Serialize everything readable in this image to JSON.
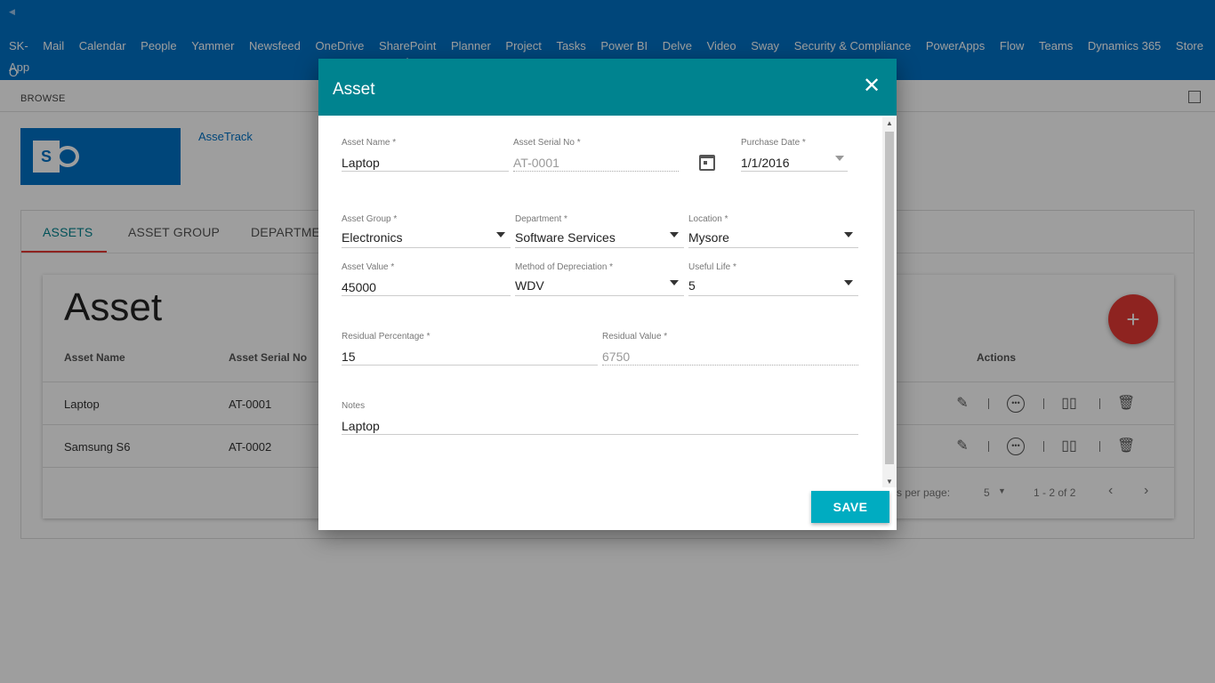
{
  "suite": {
    "links": [
      "SK-",
      "Mail",
      "Calendar",
      "People",
      "Yammer",
      "Newsfeed",
      "OneDrive",
      "SharePoint",
      "Planner",
      "Project",
      "Tasks",
      "Power BI",
      "Delve",
      "Video",
      "Sway",
      "Security & Compliance",
      "PowerApps",
      "Flow",
      "Teams",
      "Dynamics 365",
      "Store",
      "O"
    ],
    "app_label": "App",
    "active": "SharePoint"
  },
  "ribbon": {
    "browse": "BROWSE"
  },
  "site": {
    "logo_letter": "S",
    "title": "AsseTrack"
  },
  "tabs": [
    {
      "label": "ASSETS"
    },
    {
      "label": "ASSET GROUP"
    },
    {
      "label": "DEPARTMEN"
    }
  ],
  "table": {
    "title": "Asset",
    "headers": [
      "Asset Name",
      "Asset Serial No",
      "Actions"
    ],
    "rows": [
      {
        "name": "Laptop",
        "serial": "AT-0001"
      },
      {
        "name": "Samsung S6",
        "serial": "AT-0002"
      }
    ],
    "pager": {
      "rows_per_page_label": "s per page:",
      "rows_per_page": "5",
      "range": "1 - 2 of 2"
    },
    "fab_label": "+"
  },
  "dialog": {
    "title": "Asset",
    "close_symbol": "✕",
    "fields": {
      "asset_name": {
        "label": "Asset Name *",
        "value": "Laptop"
      },
      "serial_no": {
        "label": "Asset Serial No *",
        "value": "AT-0001"
      },
      "purchase_date": {
        "label": "Purchase Date *",
        "value": "1/1/2016"
      },
      "asset_group": {
        "label": "Asset Group *",
        "value": "Electronics"
      },
      "department": {
        "label": "Department *",
        "value": "Software Services"
      },
      "location": {
        "label": "Location *",
        "value": "Mysore"
      },
      "asset_value": {
        "label": "Asset Value *",
        "value": "45000"
      },
      "depreciation": {
        "label": "Method of Depreciation *",
        "value": "WDV"
      },
      "useful_life": {
        "label": "Useful Life *",
        "value": "5"
      },
      "residual_pct": {
        "label": "Residual Percentage *",
        "value": "15"
      },
      "residual_value": {
        "label": "Residual Value *",
        "value": "6750"
      },
      "notes": {
        "label": "Notes",
        "value": "Laptop"
      }
    },
    "save_label": "SAVE"
  },
  "colors": {
    "suite": "#0072c6",
    "dialog_header": "#00838f",
    "save": "#00acc1",
    "fab": "#e53935"
  }
}
